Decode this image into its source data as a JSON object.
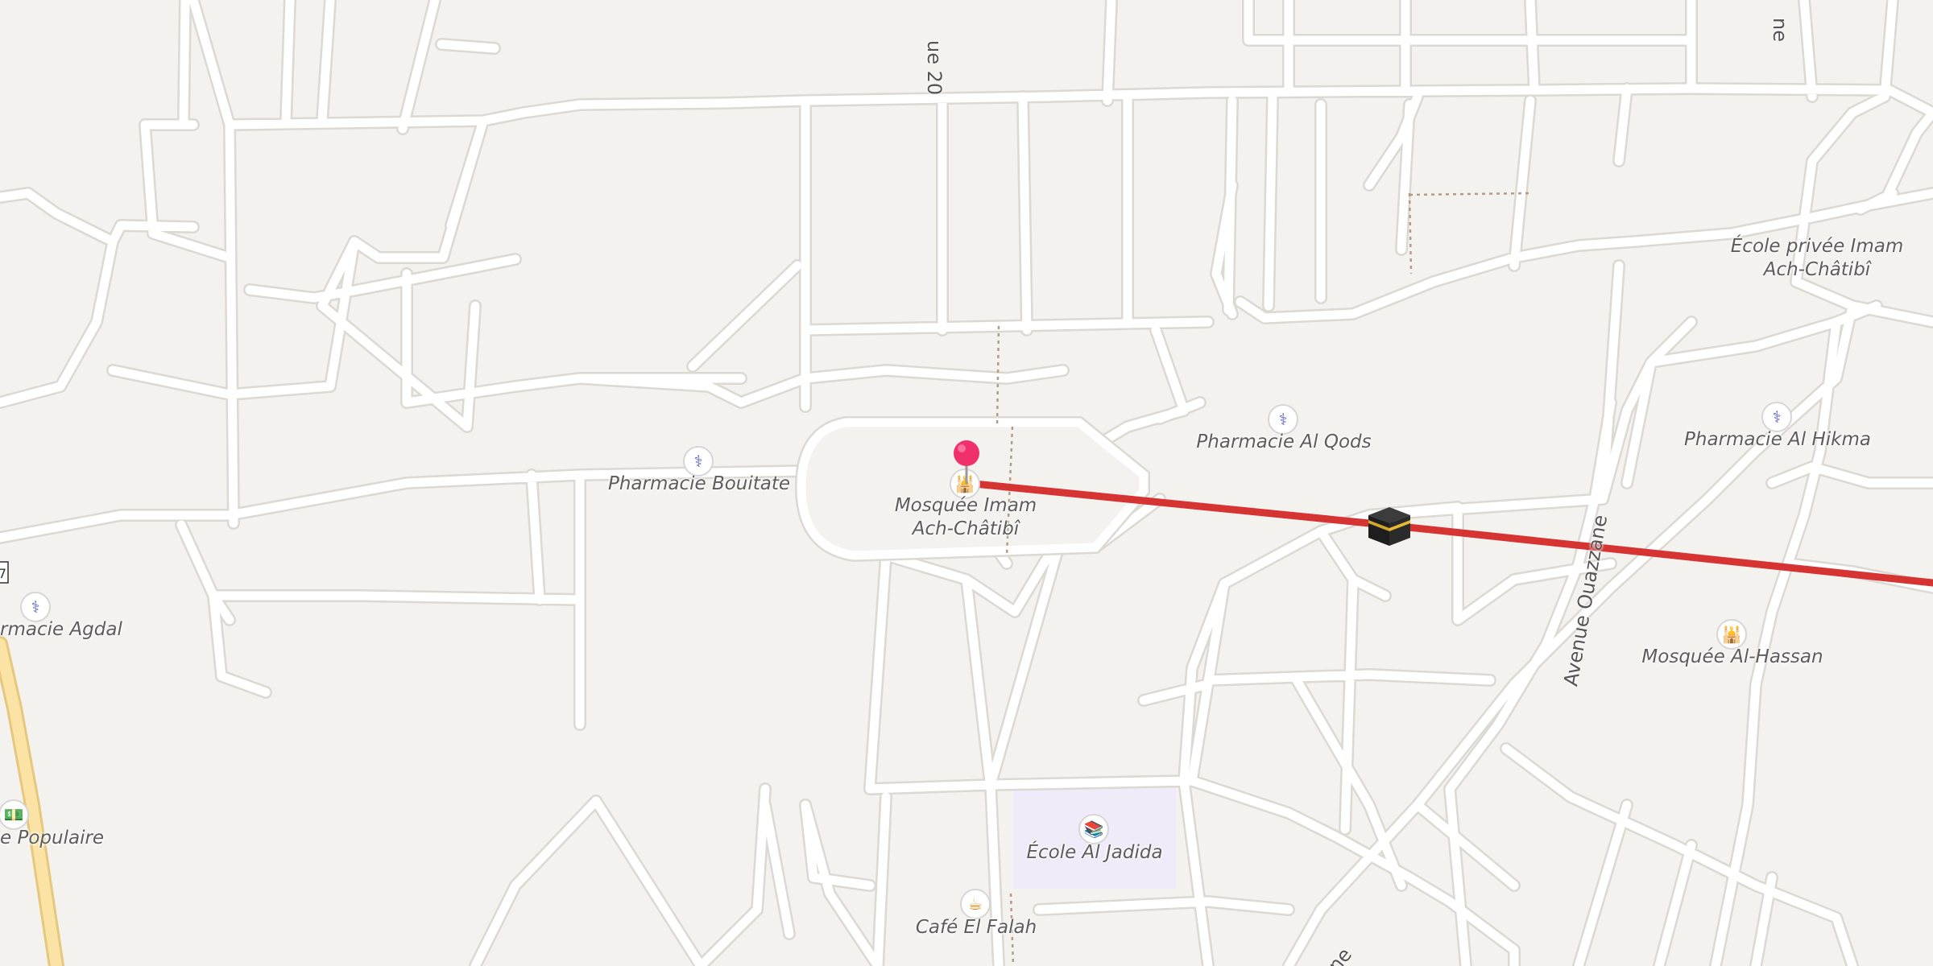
{
  "map": {
    "colors": {
      "background": "#f4f2ee",
      "road": "#ffffff",
      "road_casing": "#dcd8d2",
      "major_road": "#fbe3a6",
      "major_road_casing": "#e6c77e",
      "school_area": "#efebf8",
      "route_line": "#d63333",
      "pin": "#f0306a",
      "path": "#b69a86"
    },
    "labels": {
      "pharmacie_bouitate": "Pharmacie Bouitate",
      "mosquee_imam_line1": "Mosquée Imam",
      "mosquee_imam_line2": "Ach-Châtibî",
      "pharmacie_al_qods": "Pharmacie Al Qods",
      "pharmacie_al_hikma": "Pharmacie Al Hikma",
      "ecole_privee_line1": "École privée Imam",
      "ecole_privee_line2": "Ach-Châtibî",
      "mosquee_al_hassan": "Mosquée Al-Hassan",
      "ecole_al_jadida": "École Al Jadida",
      "cafe_el_falah": "Café El Falah",
      "pharmacie_agdal": "rmacie Agdal",
      "banque_populaire": "e Populaire"
    },
    "streets": {
      "rue_20": "ue 20",
      "avenue_ouazzane": "Avenue Ouazzane",
      "top_right_fragment": "ne",
      "bottom_fragment": "ne"
    },
    "road_shield": "7",
    "icons": {
      "pharmacy": "pharmacy-icon",
      "mosque": "mosque-icon",
      "school": "school-icon",
      "cafe": "cafe-icon",
      "bank": "bank-icon",
      "pin": "location-pin-icon",
      "kaaba": "kaaba-icon"
    }
  }
}
